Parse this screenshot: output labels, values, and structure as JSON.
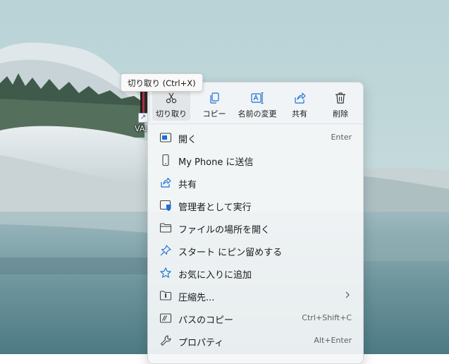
{
  "desktop": {
    "icon_label": "VAL"
  },
  "tooltip": "切り取り (Ctrl+X)",
  "toolbar": {
    "cut_label": "切り取り",
    "copy_label": "コピー",
    "rename_label": "名前の変更",
    "share_label": "共有",
    "delete_label": "削除"
  },
  "menu": {
    "items": [
      {
        "label": "開く",
        "shortcut": "Enter",
        "icon": "open-icon"
      },
      {
        "label": "My Phone に送信",
        "shortcut": "",
        "icon": "phone-icon"
      },
      {
        "label": "共有",
        "shortcut": "",
        "icon": "share-icon"
      },
      {
        "label": "管理者として実行",
        "shortcut": "",
        "icon": "admin-shield-icon"
      },
      {
        "label": "ファイルの場所を開く",
        "shortcut": "",
        "icon": "folder-icon"
      },
      {
        "label": "スタート にピン留めする",
        "shortcut": "",
        "icon": "pin-icon"
      },
      {
        "label": "お気に入りに追加",
        "shortcut": "",
        "icon": "star-icon"
      },
      {
        "label": "圧縮先...",
        "shortcut": "",
        "icon": "zip-folder-icon",
        "submenu": true
      },
      {
        "label": "パスのコピー",
        "shortcut": "Ctrl+Shift+C",
        "icon": "copy-path-icon"
      },
      {
        "label": "プロパティ",
        "shortcut": "Alt+Enter",
        "icon": "wrench-icon"
      }
    ]
  },
  "colors": {
    "accent": "#1a6fd6",
    "menu_bg": "#f4f6f8"
  }
}
